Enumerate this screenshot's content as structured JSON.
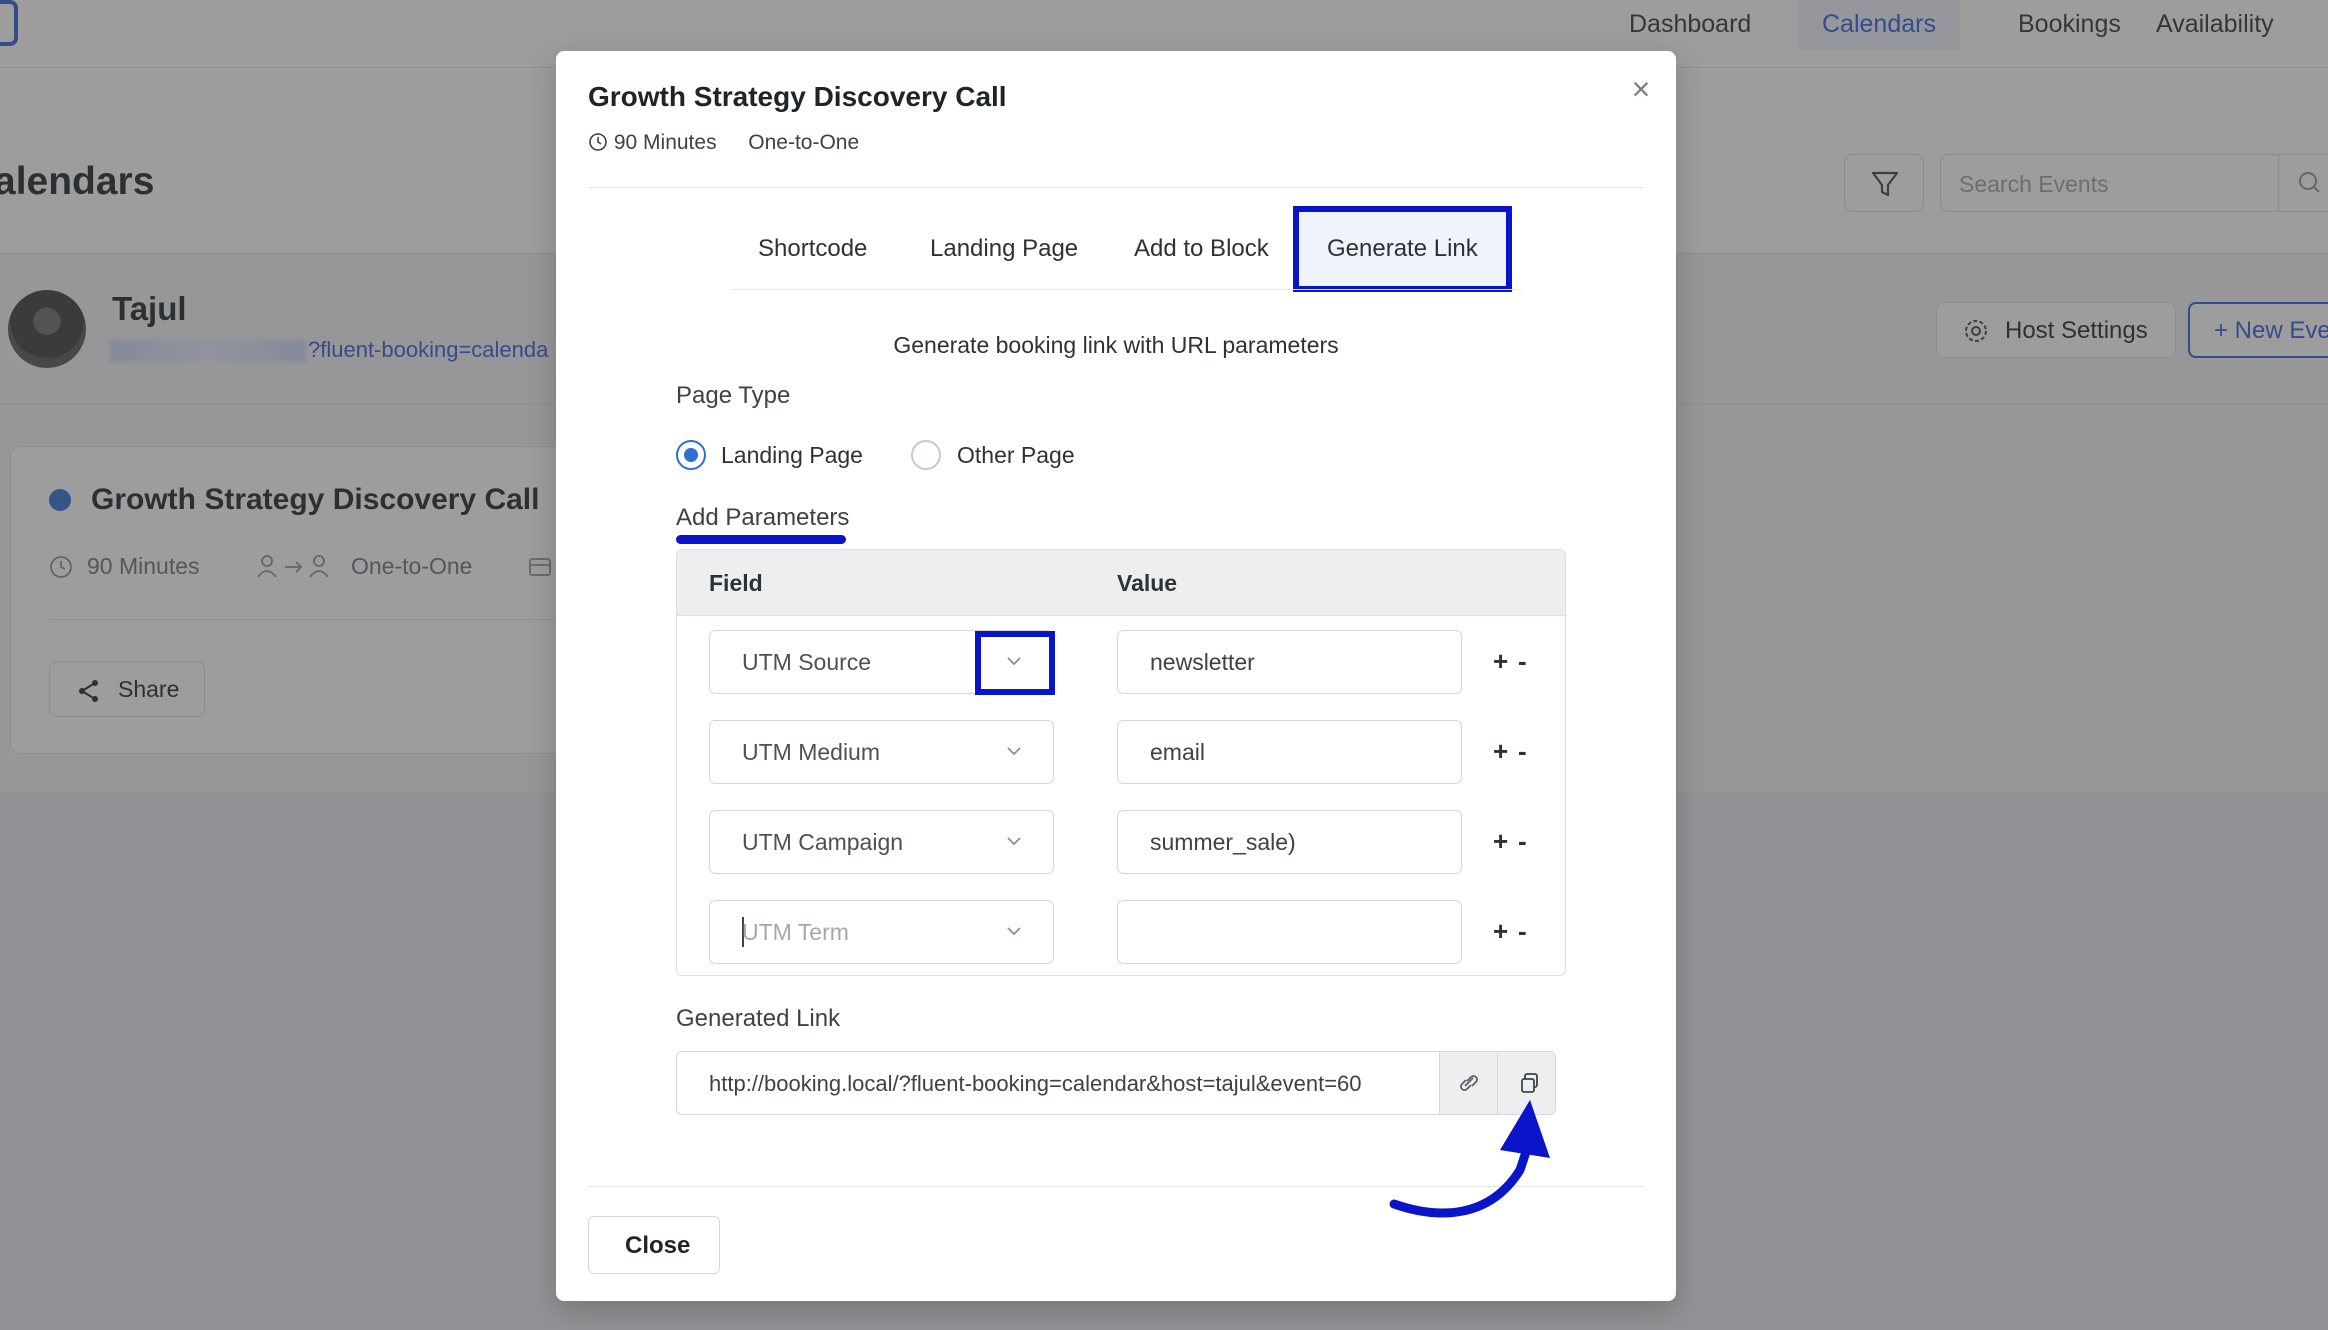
{
  "nav": {
    "items": [
      {
        "label": "Dashboard",
        "active": false
      },
      {
        "label": "Calendars",
        "active": true
      },
      {
        "label": "Bookings",
        "active": false
      },
      {
        "label": "Availability",
        "active": false
      }
    ]
  },
  "page": {
    "title": "alendars",
    "search_placeholder": "Search Events",
    "host_settings_label": "Host Settings",
    "new_event_label": "+ New Eve"
  },
  "host": {
    "name": "Tajul",
    "link_suffix": "?fluent-booking=calenda"
  },
  "event_card": {
    "title": "Growth Strategy Discovery Call",
    "duration": "90 Minutes",
    "type": "One-to-One",
    "share_label": "Share"
  },
  "modal": {
    "title": "Growth Strategy Discovery Call",
    "duration": "90 Minutes",
    "type": "One-to-One",
    "close_symbol": "×",
    "tabs": [
      {
        "label": "Shortcode",
        "active": false
      },
      {
        "label": "Landing Page",
        "active": false
      },
      {
        "label": "Add to Block",
        "active": false
      },
      {
        "label": "Generate Link",
        "active": true
      }
    ],
    "description": "Generate booking link with URL parameters",
    "page_type_label": "Page Type",
    "page_types": [
      {
        "label": "Landing Page",
        "checked": true
      },
      {
        "label": "Other Page",
        "checked": false
      }
    ],
    "add_params_label": "Add Parameters",
    "table": {
      "field_header": "Field",
      "value_header": "Value",
      "rows": [
        {
          "field": "UTM Source",
          "value": "newsletter",
          "field_placeholder": false
        },
        {
          "field": "UTM Medium",
          "value": "email",
          "field_placeholder": false
        },
        {
          "field": "UTM Campaign",
          "value": "summer_sale)",
          "field_placeholder": false
        },
        {
          "field": "UTM Term",
          "value": "",
          "field_placeholder": true
        }
      ],
      "plus": "+",
      "minus": "-"
    },
    "generated_link_label": "Generated Link",
    "generated_link": "http://booking.local/?fluent-booking=calendar&host=tajul&event=60",
    "close_label": "Close"
  },
  "colors": {
    "accent": "#2f5bd9",
    "highlight": "#0a14c8",
    "overlay": "rgba(60,60,62,0.5)"
  }
}
